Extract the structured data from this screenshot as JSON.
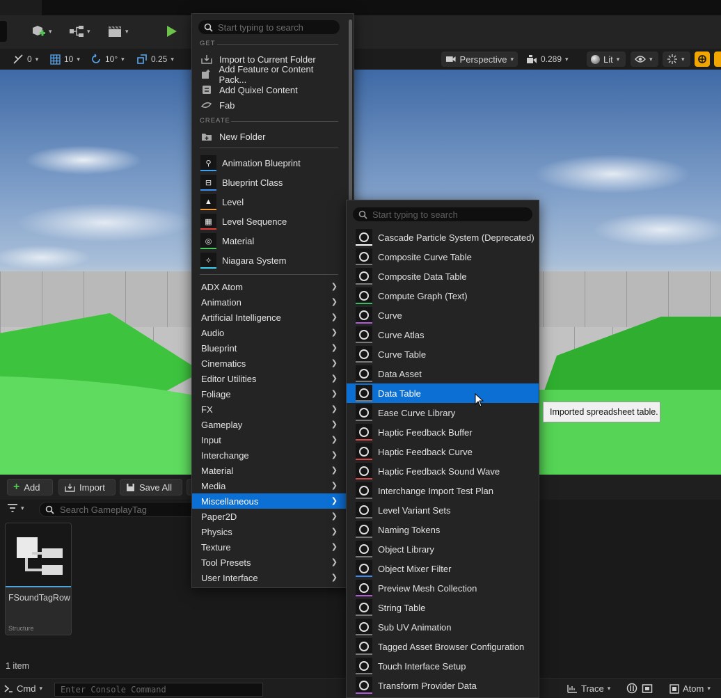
{
  "toolbar": {
    "play_icon": "play-icon",
    "add_actor_icon": "add-actor-icon",
    "blueprint_icon": "blueprint-icon",
    "cinematics_icon": "clapper-icon"
  },
  "viewport_toolbar": {
    "rotate_snap_value": "0",
    "grid_snap_value": "10",
    "rotation_snap_value": "10°",
    "scale_snap_value": "0.25",
    "view_mode": "Perspective",
    "camera_speed": "0.289",
    "lighting_mode": "Lit"
  },
  "main_menu": {
    "search_placeholder": "Start typing to search",
    "section_get": "GET",
    "get_items": [
      {
        "label": "Import to Current Folder",
        "icon": "import-icon"
      },
      {
        "label": "Add Feature or Content Pack...",
        "icon": "feature-pack-icon"
      },
      {
        "label": "Add Quixel Content",
        "icon": "quixel-icon"
      },
      {
        "label": "Fab",
        "icon": "fab-icon"
      }
    ],
    "section_create": "CREATE",
    "new_folder": "New Folder",
    "asset_items": [
      {
        "label": "Animation Blueprint",
        "color": "#3da2f3"
      },
      {
        "label": "Blueprint Class",
        "color": "#3d8ef3"
      },
      {
        "label": "Level",
        "color": "#f39c3d"
      },
      {
        "label": "Level Sequence",
        "color": "#e03c3c"
      },
      {
        "label": "Material",
        "color": "#47c960"
      },
      {
        "label": "Niagara System",
        "color": "#3dd1f3"
      }
    ],
    "categories": [
      "ADX Atom",
      "Animation",
      "Artificial Intelligence",
      "Audio",
      "Blueprint",
      "Cinematics",
      "Editor Utilities",
      "Foliage",
      "FX",
      "Gameplay",
      "Input",
      "Interchange",
      "Material",
      "Media",
      "Miscellaneous",
      "Paper2D",
      "Physics",
      "Texture",
      "Tool Presets",
      "User Interface"
    ],
    "selected_category": "Miscellaneous"
  },
  "sub_menu": {
    "search_placeholder": "Start typing to search",
    "items": [
      {
        "label": "Cascade Particle System (Deprecated)",
        "color": "#ffffff"
      },
      {
        "label": "Composite Curve Table",
        "color": "#7a7a7a"
      },
      {
        "label": "Composite Data Table",
        "color": "#7a7a7a"
      },
      {
        "label": "Compute Graph (Text)",
        "color": "#3fb868"
      },
      {
        "label": "Curve",
        "color": "#b05cd6"
      },
      {
        "label": "Curve Atlas",
        "color": "#7a7a7a"
      },
      {
        "label": "Curve Table",
        "color": "#7a7a7a"
      },
      {
        "label": "Data Asset",
        "color": "#7a7a7a"
      },
      {
        "label": "Data Table",
        "color": "#7a7a7a"
      },
      {
        "label": "Ease Curve Library",
        "color": "#7a7a7a"
      },
      {
        "label": "Haptic Feedback Buffer",
        "color": "#d64a4a"
      },
      {
        "label": "Haptic Feedback Curve",
        "color": "#d64a4a"
      },
      {
        "label": "Haptic Feedback Sound Wave",
        "color": "#d64a4a"
      },
      {
        "label": "Interchange Import Test Plan",
        "color": "#7a7a7a"
      },
      {
        "label": "Level Variant Sets",
        "color": "#7a7a7a"
      },
      {
        "label": "Naming Tokens",
        "color": "#7a7a7a"
      },
      {
        "label": "Object Library",
        "color": "#7a7a7a"
      },
      {
        "label": "Object Mixer Filter",
        "color": "#3d8ef3"
      },
      {
        "label": "Preview Mesh Collection",
        "color": "#b05cd6"
      },
      {
        "label": "String Table",
        "color": "#7a7a7a"
      },
      {
        "label": "Sub UV Animation",
        "color": "#7a7a7a"
      },
      {
        "label": "Tagged Asset Browser Configuration",
        "color": "#7a7a7a"
      },
      {
        "label": "Touch Interface Setup",
        "color": "#7a7a7a"
      },
      {
        "label": "Transform Provider Data",
        "color": "#b05cd6"
      }
    ],
    "selected_item": "Data Table"
  },
  "tooltip": "Imported spreadsheet table.",
  "content_browser": {
    "add_label": "Add",
    "import_label": "Import",
    "save_all_label": "Save All",
    "search_placeholder": "Search GameplayTag",
    "asset": {
      "name": "FSoundTagRow",
      "type": "Structure"
    },
    "item_count": "1 item"
  },
  "status_bar": {
    "cmd_label": "Cmd",
    "console_placeholder": "Enter Console Command",
    "trace_label": "Trace",
    "atom_label": "Atom"
  }
}
